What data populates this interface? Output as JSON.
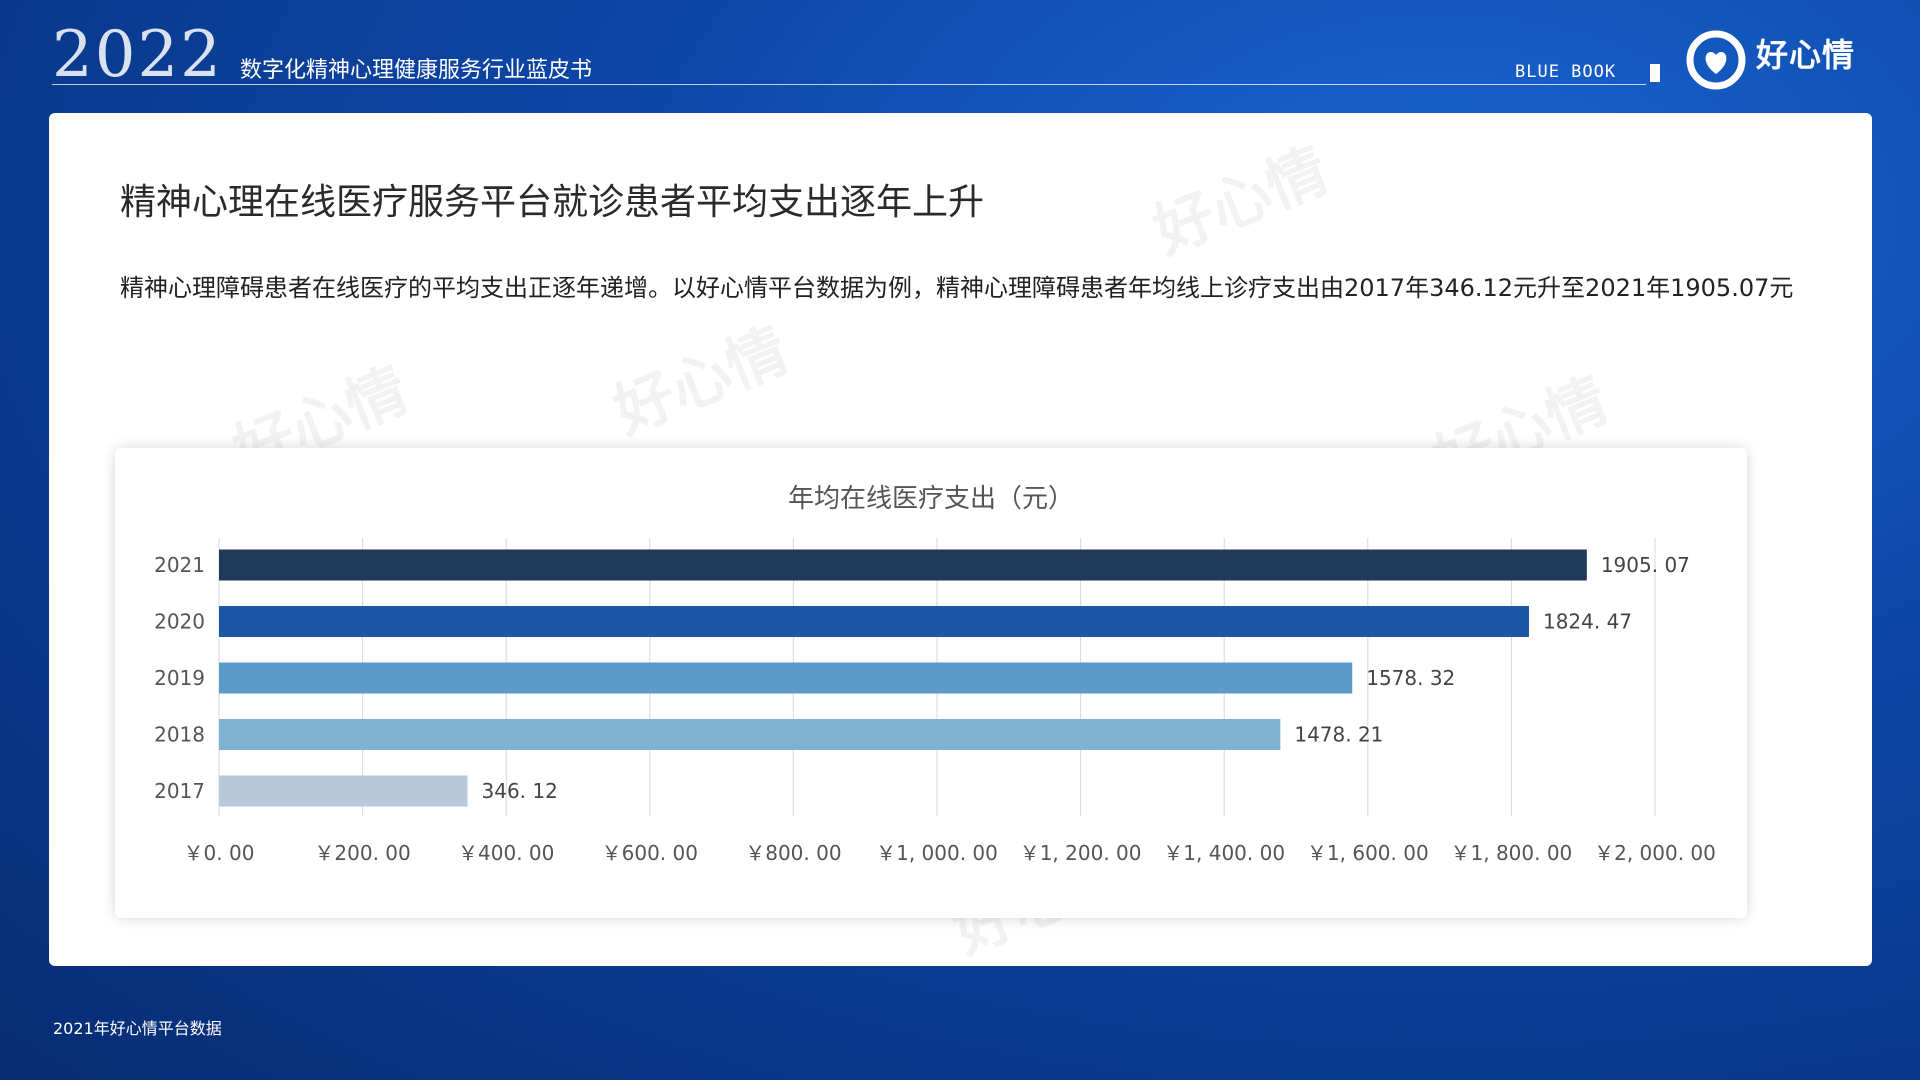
{
  "header": {
    "year": "2022",
    "title": "数字化精神心理健康服务行业蓝皮书",
    "bluebook": "BLUE BOOK",
    "logo_text": "好心情",
    "logo_icon": "heart-ring-icon"
  },
  "card": {
    "title": "精神心理在线医疗服务平台就诊患者平均支出逐年上升",
    "description": "精神心理障碍患者在线医疗的平均支出正逐年递增。以好心情平台数据为例，精神心理障碍患者年均线上诊疗支出由2017年346.12元升至2021年1905.07元",
    "watermark_text": "好心情"
  },
  "chart_data": {
    "type": "bar",
    "orientation": "horizontal",
    "title": "年均在线医疗支出（元）",
    "categories": [
      "2021",
      "2020",
      "2019",
      "2018",
      "2017"
    ],
    "values": [
      1905.07,
      1824.47,
      1578.32,
      1478.21,
      346.12
    ],
    "value_labels": [
      "1905. 07",
      "1824. 47",
      "1578. 32",
      "1478. 21",
      "346. 12"
    ],
    "bar_colors": [
      "#223a5a",
      "#1b57a5",
      "#5b9bc8",
      "#7fb1d0",
      "#b7c9da"
    ],
    "xlim": [
      0,
      2000
    ],
    "xticks": [
      0,
      200,
      400,
      600,
      800,
      1000,
      1200,
      1400,
      1600,
      1800,
      2000
    ],
    "xtick_labels": [
      "￥0. 00",
      "￥200. 00",
      "￥400. 00",
      "￥600. 00",
      "￥800. 00",
      "￥1, 000. 00",
      "￥1, 200. 00",
      "￥1, 400. 00",
      "￥1, 600. 00",
      "￥1, 800. 00",
      "￥2, 000. 00"
    ],
    "grid": true,
    "legend": "none"
  },
  "footer": {
    "source": "2021年好心情平台数据"
  }
}
